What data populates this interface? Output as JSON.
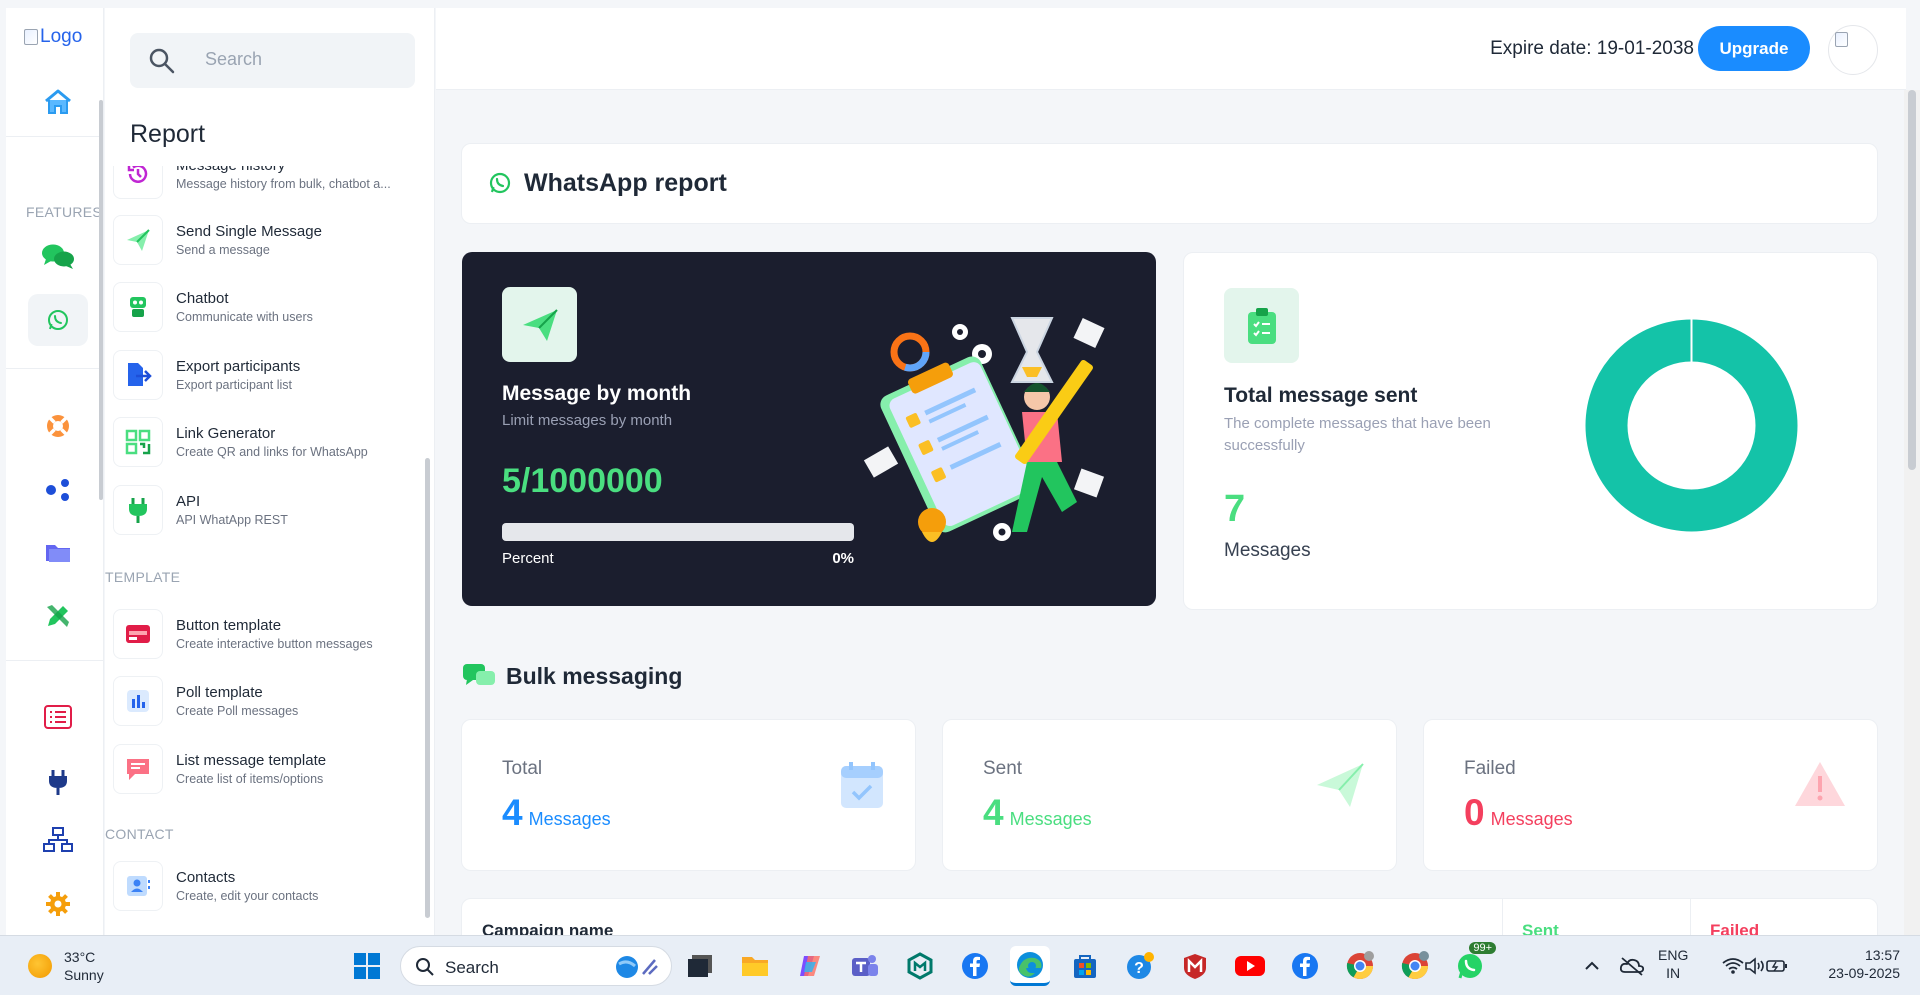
{
  "rail": {
    "logo_alt": "Logo",
    "features_label": "FEATURES"
  },
  "panel": {
    "search_placeholder": "Search",
    "title": "Report",
    "items": [
      {
        "title": "Message history",
        "desc": "Message history from bulk, chatbot a..."
      },
      {
        "title": "Send Single Message",
        "desc": "Send a message"
      },
      {
        "title": "Chatbot",
        "desc": "Communicate with users"
      },
      {
        "title": "Export participants",
        "desc": "Export participant list"
      },
      {
        "title": "Link Generator",
        "desc": "Create QR and links for WhatsApp"
      },
      {
        "title": "API",
        "desc": "API WhatApp REST"
      }
    ],
    "template_label": "TEMPLATE",
    "template_items": [
      {
        "title": "Button template",
        "desc": "Create interactive button messages"
      },
      {
        "title": "Poll template",
        "desc": "Create Poll messages"
      },
      {
        "title": "List message template",
        "desc": "Create list of items/options"
      }
    ],
    "contact_label": "CONTACT",
    "contact_items": [
      {
        "title": "Contacts",
        "desc": "Create, edit your contacts"
      }
    ]
  },
  "header": {
    "expire": "Expire date: 19-01-2038",
    "upgrade_label": "Upgrade"
  },
  "whatsapp_report": {
    "title": "WhatsApp report",
    "monthly": {
      "title": "Message by month",
      "subtitle": "Limit messages by month",
      "value": "5/1000000",
      "percent_label": "Percent",
      "percent_value": "0%",
      "progress_fraction": 0.0
    },
    "total": {
      "title": "Total message sent",
      "subtitle": "The complete messages that have been successfully",
      "count": "7",
      "unit": "Messages"
    }
  },
  "bulk": {
    "title": "Bulk messaging",
    "stats": [
      {
        "label": "Total",
        "value": "4",
        "unit": "Messages",
        "color": "#1a8cff"
      },
      {
        "label": "Sent",
        "value": "4",
        "unit": "Messages",
        "color": "#4ade80"
      },
      {
        "label": "Failed",
        "value": "0",
        "unit": "Messages",
        "color": "#f43f5e"
      }
    ],
    "table_headers": [
      "Campaign name",
      "Sent",
      "Failed"
    ]
  },
  "taskbar": {
    "temp": "33°C",
    "weather": "Sunny",
    "search": "Search",
    "lang1": "ENG",
    "lang2": "IN",
    "time": "13:57",
    "date": "23-09-2025",
    "whatsapp_badge": "99+"
  },
  "colors": {
    "accent_blue": "#1a8cff",
    "green": "#4ade80",
    "teal_donut": "#14c3a8",
    "red": "#f43f5e",
    "dark_card": "#1b1e2e"
  }
}
